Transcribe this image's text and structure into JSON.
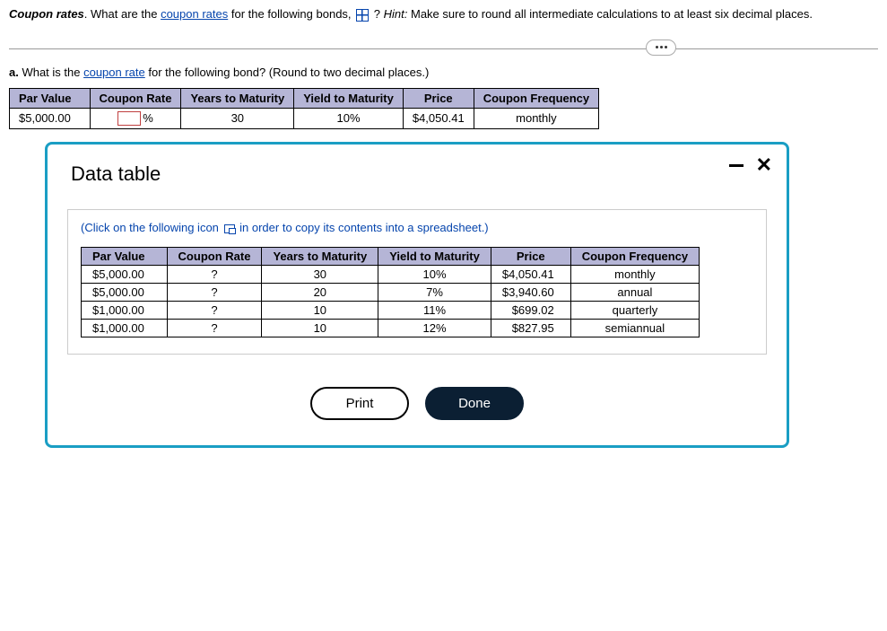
{
  "intro": {
    "title_bold": "Coupon rates",
    "sentence_prefix": ". What are the ",
    "link1": "coupon rates",
    "sentence_mid": " for the following bonds, ",
    "question_mark": "?",
    "hint_label": "Hint:",
    "hint_text": " Make sure to round all intermediate calculations to at least six decimal places."
  },
  "partA": {
    "label": "a.",
    "prompt_prefix": " What is the ",
    "prompt_link": "coupon rate",
    "prompt_suffix": " for the following bond?  (Round to two decimal places.)"
  },
  "mainTable": {
    "headers": [
      "Par Value",
      "Coupon Rate",
      "Years to Maturity",
      "Yield to Maturity",
      "Price",
      "Coupon Frequency"
    ],
    "row": {
      "par": "$5,000.00",
      "coupon_suffix": "%",
      "years": "30",
      "ytm": "10%",
      "price": "$4,050.41",
      "freq": "monthly"
    }
  },
  "popup": {
    "title": "Data table",
    "instruction_prefix": "(Click on the following icon ",
    "instruction_suffix": " in order to copy its contents into a spreadsheet.)",
    "headers": [
      "Par Value",
      "Coupon Rate",
      "Years to Maturity",
      "Yield to Maturity",
      "Price",
      "Coupon Frequency"
    ],
    "rows": [
      {
        "par": "$5,000.00",
        "coupon": "?",
        "years": "30",
        "ytm": "10%",
        "price": "$4,050.41",
        "freq": "monthly"
      },
      {
        "par": "$5,000.00",
        "coupon": "?",
        "years": "20",
        "ytm": "7%",
        "price": "$3,940.60",
        "freq": "annual"
      },
      {
        "par": "$1,000.00",
        "coupon": "?",
        "years": "10",
        "ytm": "11%",
        "price": "$699.02",
        "freq": "quarterly"
      },
      {
        "par": "$1,000.00",
        "coupon": "?",
        "years": "10",
        "ytm": "12%",
        "price": "$827.95",
        "freq": "semiannual"
      }
    ],
    "buttons": {
      "print": "Print",
      "done": "Done"
    }
  },
  "chart_data": {
    "type": "table",
    "title": "Bond coupon-rate data",
    "columns": [
      "Par Value",
      "Coupon Rate",
      "Years to Maturity",
      "Yield to Maturity",
      "Price",
      "Coupon Frequency"
    ],
    "rows": [
      [
        "$5,000.00",
        "?",
        30,
        "10%",
        "$4,050.41",
        "monthly"
      ],
      [
        "$5,000.00",
        "?",
        20,
        "7%",
        "$3,940.60",
        "annual"
      ],
      [
        "$1,000.00",
        "?",
        10,
        "11%",
        "$699.02",
        "quarterly"
      ],
      [
        "$1,000.00",
        "?",
        10,
        "12%",
        "$827.95",
        "semiannual"
      ]
    ]
  }
}
